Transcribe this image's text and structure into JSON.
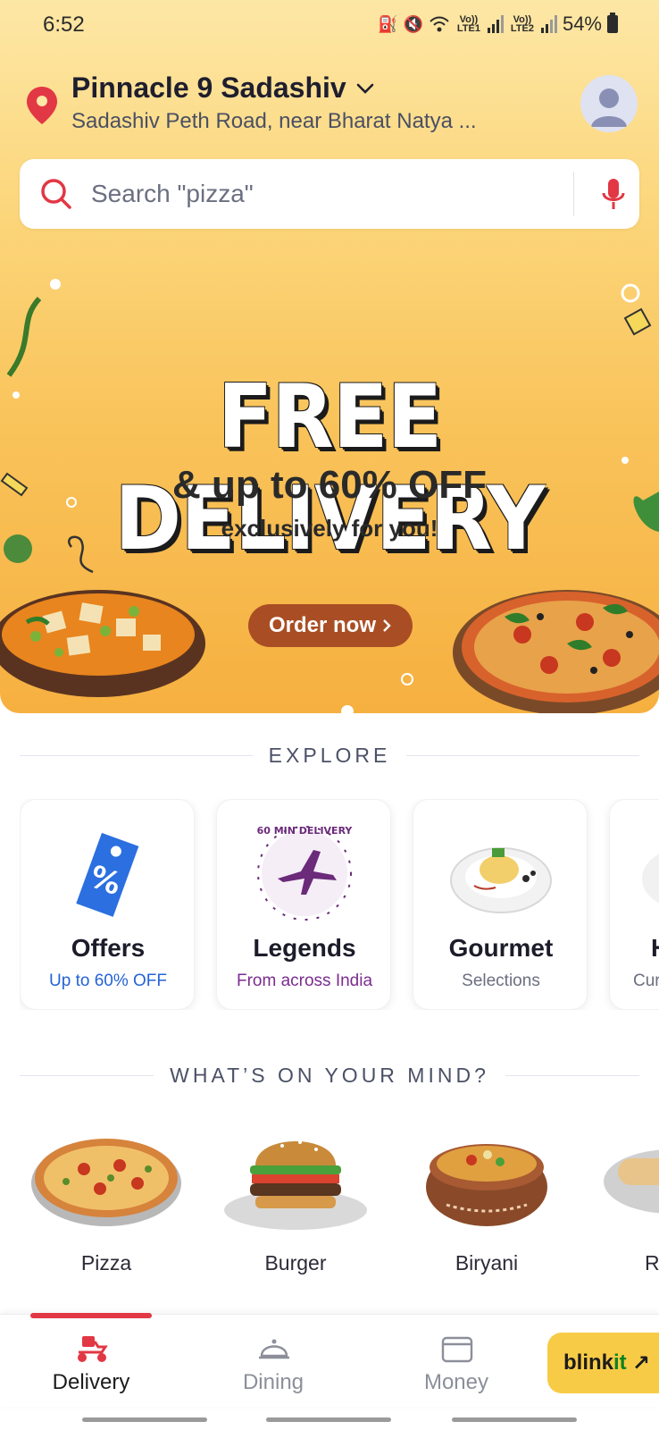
{
  "status_bar": {
    "time": "6:52",
    "sim1": "Vo)) LTE1",
    "sim2": "Vo)) LTE2",
    "battery": "54%"
  },
  "location": {
    "title": "Pinnacle 9 Sadashiv",
    "subtitle": "Sadashiv Peth Road, near Bharat Natya ..."
  },
  "search": {
    "placeholder": "Search \"pizza\""
  },
  "banner": {
    "title": "FREE DELIVERY",
    "subtitle": "& up to 60% OFF",
    "subtitle2": "exclusively for you!",
    "cta": "Order now",
    "cta_icon": "chevron-right-icon"
  },
  "explore": {
    "header": "EXPLORE",
    "cards": [
      {
        "title": "Offers",
        "subtitle": "Up to 60% OFF",
        "subtitle_color": "#2563d6",
        "icon": "discount-tag-icon"
      },
      {
        "title": "Legends",
        "subtitle": "From across India",
        "subtitle_color": "#7b2c8f",
        "icon": "airplane-icon",
        "badge_text": "60 MIN DELIVERY"
      },
      {
        "title": "Gourmet",
        "subtitle": "Selections",
        "subtitle_color": "#6b6f80",
        "icon": "gourmet-plate-icon"
      },
      {
        "title": "H",
        "subtitle": "Cur",
        "subtitle_color": "#6b6f80",
        "icon": "food-icon"
      }
    ]
  },
  "mind": {
    "header": "WHAT’S ON YOUR MIND?",
    "items": [
      {
        "label": "Pizza"
      },
      {
        "label": "Burger"
      },
      {
        "label": "Biryani"
      },
      {
        "label": "R"
      }
    ]
  },
  "nav": {
    "delivery": "Delivery",
    "dining": "Dining",
    "money": "Money",
    "blinkit_main": "blink",
    "blinkit_it": "it",
    "blinkit_arrow": "↗"
  },
  "colors": {
    "brand_red": "#e23744",
    "blinkit_yellow": "#f8cb46",
    "order_button": "#a94e24"
  }
}
